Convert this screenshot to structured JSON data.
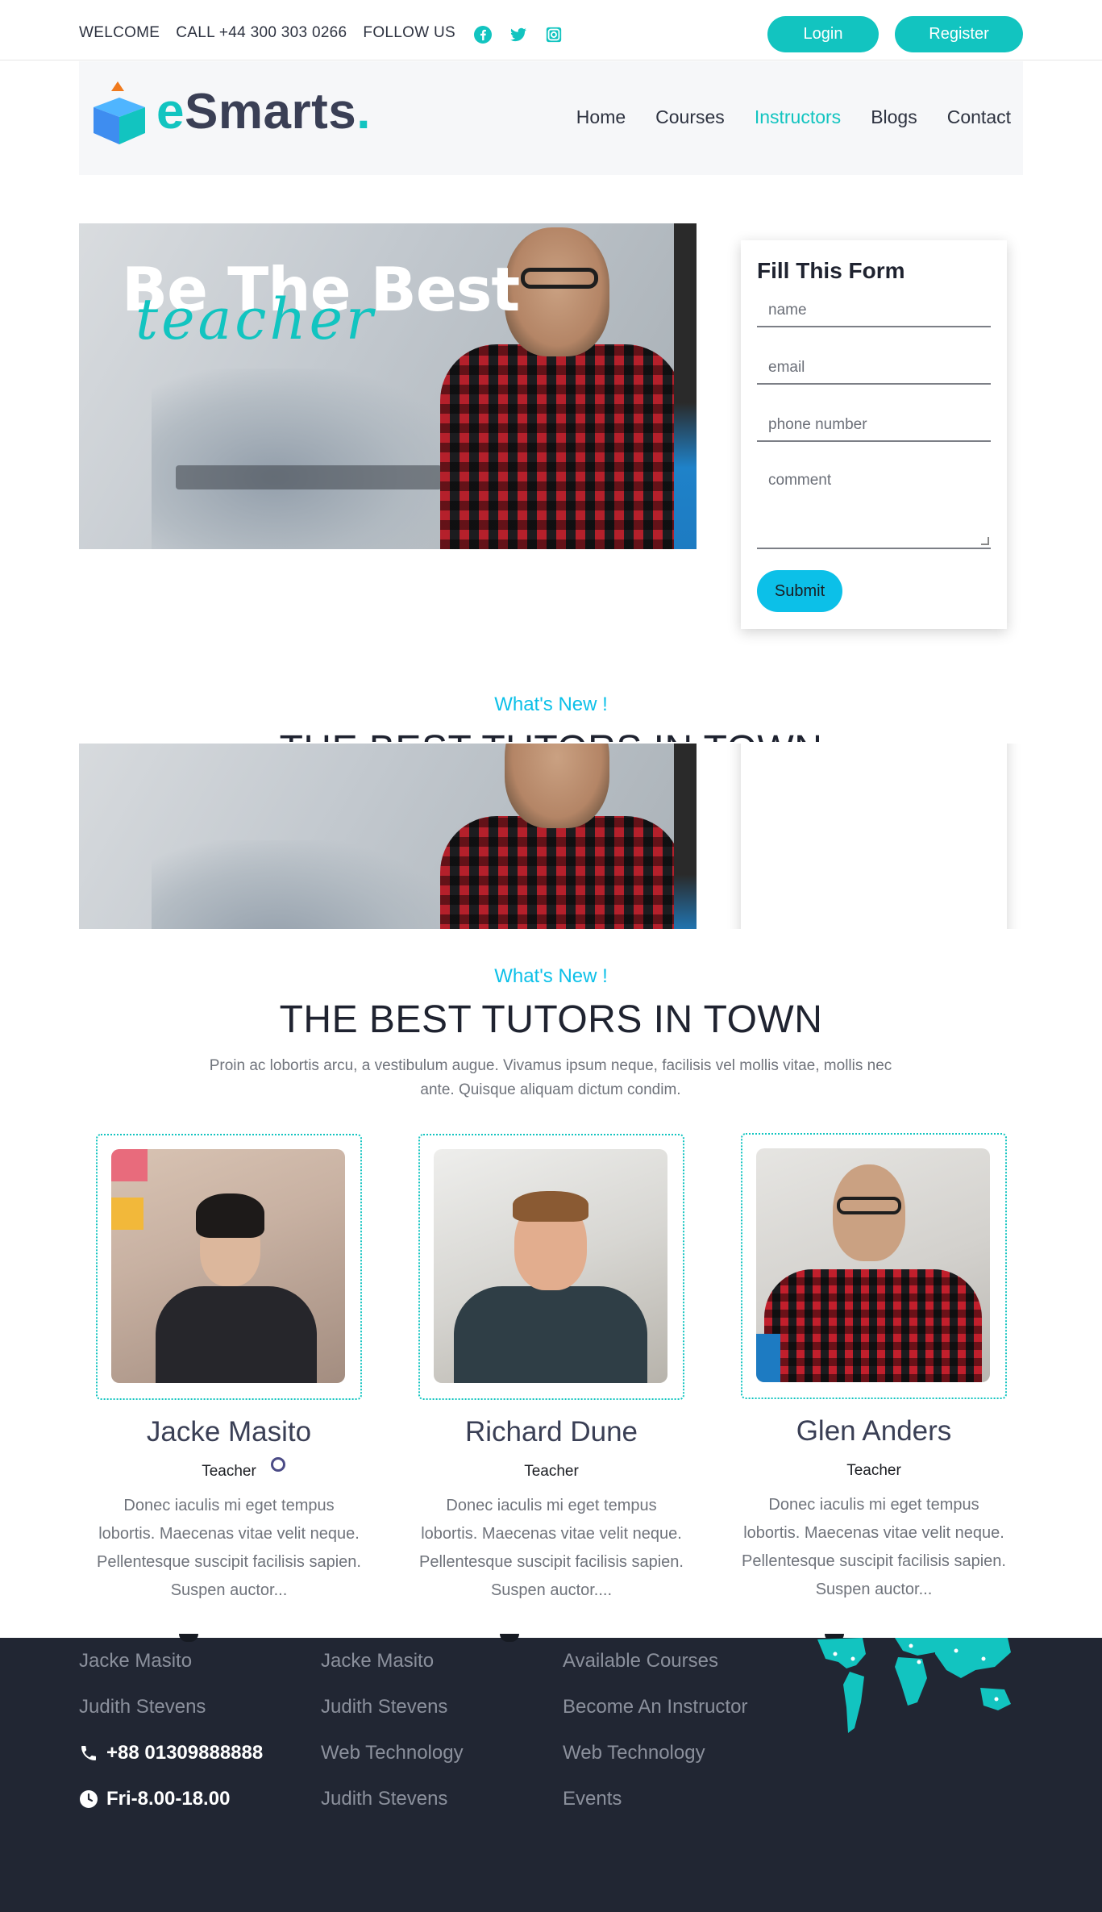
{
  "topbar": {
    "welcome": "WELCOME",
    "call": "CALL +44 300 303 0266",
    "follow": "FOLLOW US",
    "social_icons": [
      "facebook-icon",
      "twitter-icon",
      "instagram-icon"
    ],
    "login": "Login",
    "register": "Register"
  },
  "brand": {
    "e": "e",
    "rest": "Smarts",
    "dot": ".",
    "accent": "#12c4c0"
  },
  "nav": {
    "items": [
      "Home",
      "Courses",
      "Instructors",
      "Blogs",
      "Contact"
    ],
    "active": "Instructors"
  },
  "hero": {
    "title": "Be The Best",
    "script": "teacher"
  },
  "form": {
    "heading": "Fill This Form",
    "name_placeholder": "name",
    "email_placeholder": "email",
    "phone_placeholder": "phone number",
    "comment_placeholder": "comment",
    "submit": "Submit"
  },
  "section": {
    "kicker": "What's New !",
    "title": "THE BEST TUTORS IN TOWN",
    "description": "Proin ac lobortis arcu, a vestibulum augue. Vivamus ipsum neque, facilisis vel mollis vitae, mollis nec ante. Quisque aliquam dictum condim."
  },
  "tutors": [
    {
      "name": "Jacke Masito",
      "role": "Teacher",
      "bio": "Donec iaculis mi eget tempus lobortis. Maecenas vitae velit neque. Pellentesque suscipit facilisis sapien. Suspen auctor..."
    },
    {
      "name": "Richard Dune",
      "role": "Teacher",
      "bio": "Donec iaculis mi eget tempus lobortis. Maecenas vitae velit neque. Pellentesque suscipit facilisis sapien. Suspen auctor...."
    },
    {
      "name": "Glen Anders",
      "role": "Teacher",
      "bio": "Donec iaculis mi eget tempus lobortis. Maecenas vitae velit neque. Pellentesque suscipit facilisis sapien. Suspen auctor..."
    }
  ],
  "footer": {
    "col1": [
      "Jacke Masito",
      "Judith Stevens"
    ],
    "phone": "+88 01309888888",
    "hours": "Fri-8.00-18.00",
    "col2": [
      "Jacke Masito",
      "Judith Stevens",
      "Web Technology",
      "Judith Stevens"
    ],
    "col3": [
      "Available Courses",
      "Become An Instructor",
      "Web Technology",
      "Events"
    ]
  },
  "colors": {
    "accent": "#12c4c0",
    "submit": "#0cc0e8",
    "footer_bg": "#212633"
  }
}
